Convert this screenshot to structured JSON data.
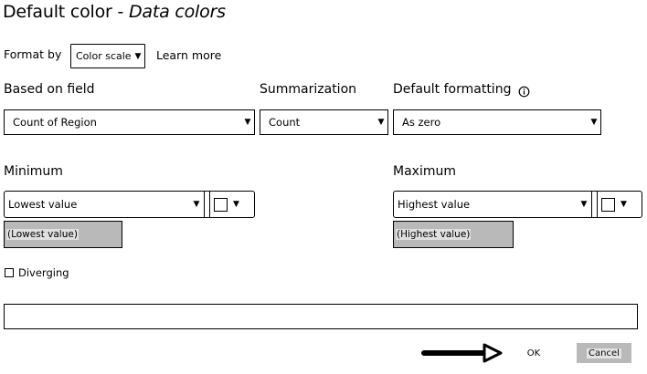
{
  "dialog": {
    "title_prefix": "Default color - ",
    "title_emphasis": "Data colors"
  },
  "format_by": {
    "label": "Format by",
    "value": "Color scale",
    "learn_more": "Learn more"
  },
  "based_on_field": {
    "label": "Based on field",
    "value": "Count of Region"
  },
  "summarization": {
    "label": "Summarization",
    "value": "Count"
  },
  "default_formatting": {
    "label": "Default formatting",
    "value": "As zero",
    "info_icon": "info-circle-icon"
  },
  "minimum": {
    "label": "Minimum",
    "value": "Lowest value",
    "color_swatch": "#ffffff",
    "preview": "(Lowest value)"
  },
  "maximum": {
    "label": "Maximum",
    "value": "Highest value",
    "color_swatch": "#ffffff",
    "preview": "(Highest value)"
  },
  "diverging": {
    "label": "Diverging",
    "checked": false
  },
  "buttons": {
    "ok": "OK",
    "cancel": "Cancel"
  },
  "annotation": {
    "arrow_icon": "arrow-right-icon",
    "color": "#000000"
  }
}
